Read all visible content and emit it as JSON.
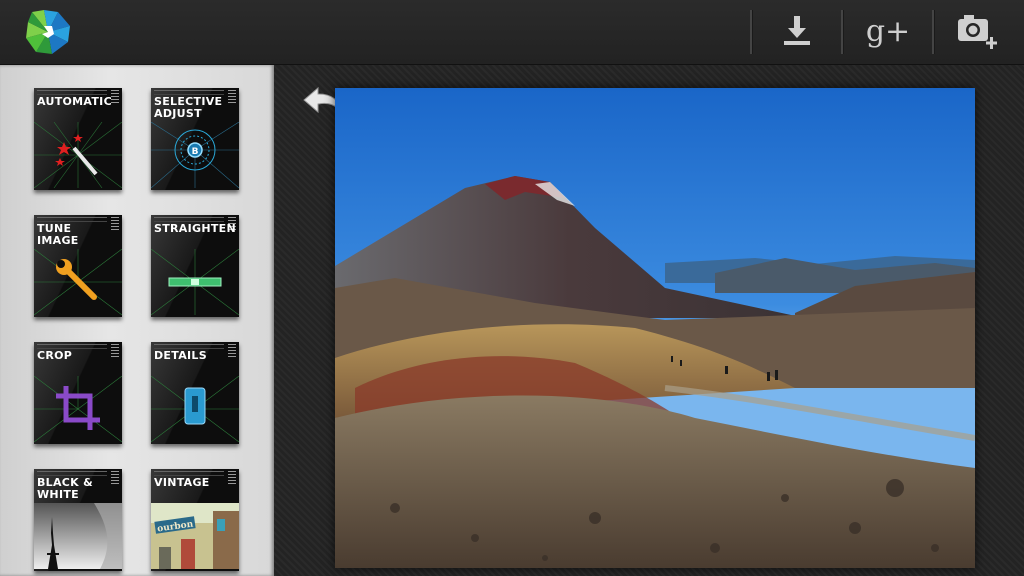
{
  "app": {
    "logo_icon": "snapseed-logo-icon"
  },
  "toolbar": {
    "icons": [
      "download-icon",
      "google-plus-icon",
      "camera-add-icon"
    ],
    "gplus_text": "g+"
  },
  "tools": [
    {
      "label": "AUTOMATIC",
      "icon": "magic-wand-icon"
    },
    {
      "label": "SELECTIVE ADJUST",
      "icon": "control-point-icon"
    },
    {
      "label": "TUNE IMAGE",
      "icon": "wrench-icon"
    },
    {
      "label": "STRAIGHTEN",
      "icon": "level-icon"
    },
    {
      "label": "CROP",
      "icon": "crop-icon"
    },
    {
      "label": "DETAILS",
      "icon": "sharpener-icon"
    },
    {
      "label": "BLACK & WHITE",
      "icon": "eiffel-tower-icon"
    },
    {
      "label": "VINTAGE",
      "icon": "vintage-photo-icon"
    }
  ],
  "selective_adjust_badge": "B",
  "vintage_sign_text": "ourbon",
  "canvas": {
    "back_icon": "back-arrow-icon",
    "photo": "mountain-landscape-photo"
  },
  "colors": {
    "topbar": "#262626",
    "panel": "#dcdcdc",
    "sky": "#2f7fd6"
  }
}
